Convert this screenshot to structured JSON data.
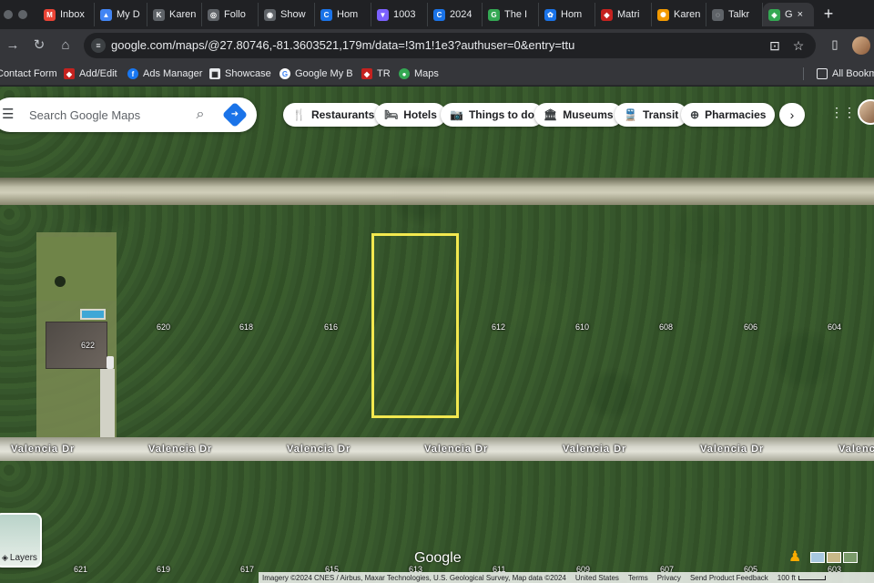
{
  "tabs": [
    {
      "title": "Inbox",
      "color": "#ea4335",
      "glyph": "M"
    },
    {
      "title": "My D",
      "color": "#4285f4",
      "glyph": "▲"
    },
    {
      "title": "Karen",
      "color": "#5f6368",
      "glyph": "K"
    },
    {
      "title": "Follo",
      "color": "#5f6368",
      "glyph": "◎"
    },
    {
      "title": "Show",
      "color": "#5f6368",
      "glyph": "◉"
    },
    {
      "title": "Hom",
      "color": "#1a73e8",
      "glyph": "C"
    },
    {
      "title": "1003",
      "color": "#7b61ff",
      "glyph": "▼"
    },
    {
      "title": "2024",
      "color": "#1a73e8",
      "glyph": "C"
    },
    {
      "title": "The I",
      "color": "#34a853",
      "glyph": "G"
    },
    {
      "title": "Hom",
      "color": "#1a73e8",
      "glyph": "✿"
    },
    {
      "title": "Matri",
      "color": "#c5221f",
      "glyph": "◆"
    },
    {
      "title": "Karen",
      "color": "#f29900",
      "glyph": "✺"
    },
    {
      "title": "Talkr",
      "color": "#5f6368",
      "glyph": "◌"
    },
    {
      "title": "G",
      "color": "#34a853",
      "glyph": "◈"
    }
  ],
  "active_tab_close": "×",
  "new_tab": "+",
  "toolbar": {
    "url": "google.com/maps/@27.80746,-81.3603521,179m/data=!3m1!1e3?authuser=0&entry=ttu",
    "back": "←",
    "forward": "→",
    "reload": "↻",
    "home": "⌂",
    "install": "⊡",
    "bookmark": "☆",
    "sidepanel": "▯"
  },
  "bookmarks": [
    {
      "label": "Contact Form",
      "color": "",
      "glyph": ""
    },
    {
      "label": "Add/Edit",
      "color": "#c5221f",
      "glyph": "◆"
    },
    {
      "label": "Ads Manager",
      "color": "#1877f2",
      "glyph": "f"
    },
    {
      "label": "Showcase",
      "color": "#e8eaed",
      "glyph": "▦"
    },
    {
      "label": "Google My B",
      "color": "#4285f4",
      "glyph": "G"
    },
    {
      "label": "TR",
      "color": "#c5221f",
      "glyph": "◆"
    },
    {
      "label": "Maps",
      "color": "#34a853",
      "glyph": "●"
    }
  ],
  "all_bookmarks": "All Bookm",
  "search": {
    "placeholder": "Search Google Maps"
  },
  "chips": [
    {
      "label": "Restaurants",
      "icon": "🍴"
    },
    {
      "label": "Hotels",
      "icon": "🛏"
    },
    {
      "label": "Things to do",
      "icon": "📷"
    },
    {
      "label": "Museums",
      "icon": "🏛"
    },
    {
      "label": "Transit",
      "icon": "🚆"
    },
    {
      "label": "Pharmacies",
      "icon": "⊕"
    }
  ],
  "chips_next": "›",
  "street_name": "Valencia Dr",
  "street_label_last": "Valenc",
  "lot_numbers_top": [
    "620",
    "622",
    "618",
    "616",
    "612",
    "610",
    "608",
    "606",
    "604"
  ],
  "lot_numbers_bottom": [
    "621",
    "619",
    "617",
    "615",
    "613",
    "611",
    "609",
    "607",
    "605",
    "603"
  ],
  "layers_label": "Layers",
  "google_logo": "Google",
  "bottom_bar": {
    "imagery": "Imagery ©2024 CNES / Airbus, Maxar Technologies, U.S. Geological Survey, Map data ©2024",
    "united_states": "United States",
    "terms": "Terms",
    "privacy": "Privacy",
    "feedback": "Send Product Feedback",
    "scale": "100 ft"
  },
  "colors": {
    "parcel_outline": "#f2e84f",
    "directions_blue": "#1a73e8"
  }
}
